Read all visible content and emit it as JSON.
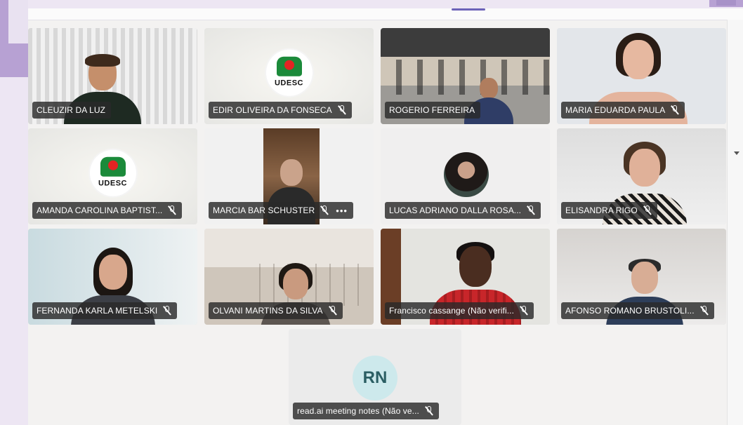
{
  "meeting": {
    "participants": [
      {
        "name": "CLEUZIR DA LUZ",
        "muted": false,
        "video": true
      },
      {
        "name": "EDIR OLIVEIRA DA FONSECA",
        "muted": true,
        "video": false,
        "logo_text": "UDESC"
      },
      {
        "name": "ROGERIO FERREIRA",
        "muted": false,
        "video": true
      },
      {
        "name": "MARIA EDUARDA PAULA",
        "muted": true,
        "video": true
      },
      {
        "name": "AMANDA CAROLINA BAPTIST...",
        "muted": true,
        "video": false,
        "logo_text": "UDESC"
      },
      {
        "name": "MARCIA BAR SCHUSTER",
        "muted": true,
        "video": true,
        "more": "•••"
      },
      {
        "name": "LUCAS ADRIANO DALLA ROSA...",
        "muted": true,
        "video": true
      },
      {
        "name": "ELISANDRA RIGO",
        "muted": true,
        "video": true
      },
      {
        "name": "FERNANDA KARLA METELSKI",
        "muted": true,
        "video": true
      },
      {
        "name": "OLVANI MARTINS DA SILVA",
        "muted": true,
        "video": true
      },
      {
        "name": "Francisco cassange (Não verifi...",
        "muted": true,
        "video": true
      },
      {
        "name": "AFONSO ROMANO BRUSTOLI...",
        "muted": true,
        "video": true
      }
    ],
    "bot_tile": {
      "initials": "RN",
      "name": "read.ai meeting notes (Não ve...",
      "muted": true
    }
  },
  "colors": {
    "accent": "#6c62b8",
    "logo_green": "#1b8a3a",
    "logo_red": "#e22423",
    "avatar_bg": "#cde9ec"
  }
}
